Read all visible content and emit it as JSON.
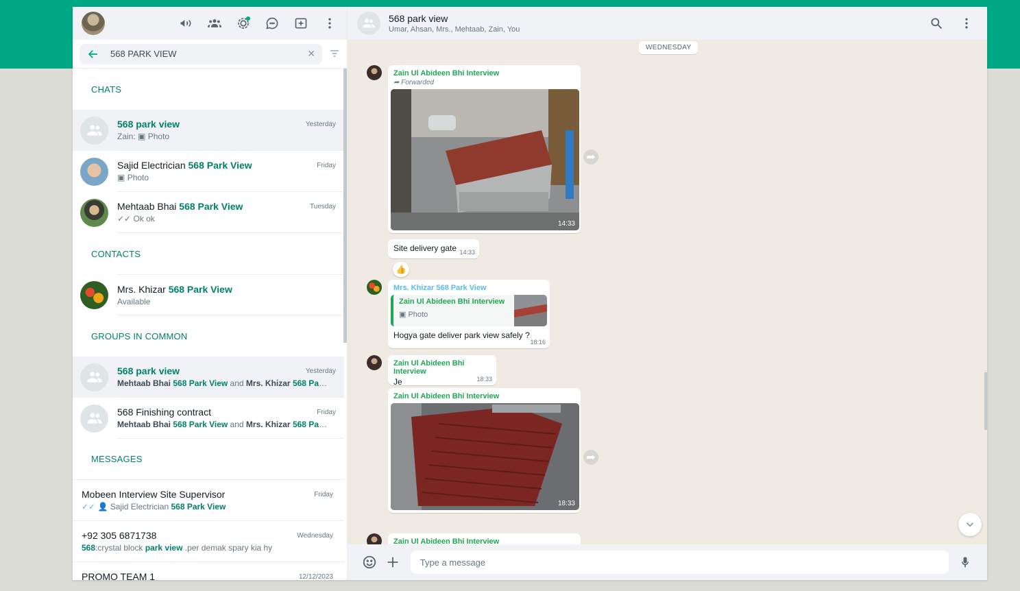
{
  "left": {
    "search": {
      "value": "568 PARK VIEW"
    },
    "sections": {
      "chats": "CHATS",
      "contacts": "CONTACTS",
      "groups": "GROUPS IN COMMON",
      "messages": "MESSAGES"
    },
    "chats": [
      {
        "name": "568 park view",
        "preview_sender": "Zain:",
        "preview": "Photo",
        "time": "Yesterday"
      },
      {
        "name_prefix": "Sajid Electrician",
        "name_hl": "568 Park View",
        "preview": "Photo",
        "time": "Friday"
      },
      {
        "name_prefix": "Mehtaab Bhai",
        "name_hl": "568 Park View",
        "preview": "Ok ok",
        "time": "Tuesday"
      }
    ],
    "contacts": [
      {
        "name_prefix": "Mrs. Khizar",
        "name_hl": "568 Park View",
        "status": "Available"
      }
    ],
    "groups": [
      {
        "name": "568 park view",
        "time": "Yesterday",
        "m1": "Mehtaab Bhai",
        "m1_hl": "568 Park View",
        "and": "and",
        "m2": "Mrs. Khizar",
        "m2_hl": "568 Park ..."
      },
      {
        "name": "568 Finishing contract",
        "time": "Friday",
        "m1": "Mehtaab Bhai",
        "m1_hl": "568 Park View",
        "and": "and",
        "m2": "Mrs. Khizar",
        "m2_hl": "568 Park ..."
      }
    ],
    "messages": [
      {
        "title": "Mobeen Interview Site Supervisor",
        "time": "Friday",
        "preview": "Sajid Electrician",
        "preview_hl": "568 Park View"
      },
      {
        "title": "+92 305 6871738",
        "time": "Wednesday",
        "hl1": "568",
        "mid": ":crystal block",
        "hl2": "park view",
        "tail": " .per demak spary kia hy"
      },
      {
        "title": "PROMO TEAM 1",
        "time": "12/12/2023"
      }
    ]
  },
  "right": {
    "group_name": "568 park view",
    "members": "Umar, Ahsan, Mrs., Mehtaab, Zain, You",
    "day_chip": "WEDNESDAY",
    "msg1": {
      "sender": "Zain Ul Abideen Bhi Interview",
      "forwarded": "Forwarded",
      "time": "14:33"
    },
    "msg2": {
      "text": "Site delivery gate",
      "time": "14:33",
      "reaction": "👍"
    },
    "msg3": {
      "sender": "Mrs. Khizar 568 Park View",
      "quote_name": "Zain Ul Abideen Bhi Interview",
      "quote_text": "Photo",
      "text": "Hogya gate deliver park view safely ?",
      "time": "18:16"
    },
    "msg4": {
      "sender": "Zain Ul Abideen Bhi Interview",
      "text": "Je",
      "time": "18:33"
    },
    "msg5": {
      "sender": "Zain Ul Abideen Bhi Interview",
      "time": "18:33"
    },
    "msg6": {
      "sender": "Zain Ul Abideen Bhi Interview"
    },
    "composer_placeholder": "Type a message"
  },
  "colors": {
    "accent": "#00a884",
    "highlight": "#008069",
    "sender_green": "#1fa855",
    "sender_blue": "#53bdeb"
  },
  "icons": [
    "communities-icon",
    "community-icon",
    "status-icon",
    "channels-icon",
    "new-chat-icon",
    "menu-icon",
    "back-icon",
    "close-icon",
    "filter-icon",
    "search-icon",
    "emoji-icon",
    "attach-icon",
    "mic-icon",
    "forward-icon",
    "chevron-down-icon",
    "camera-icon",
    "double-check-icon"
  ]
}
